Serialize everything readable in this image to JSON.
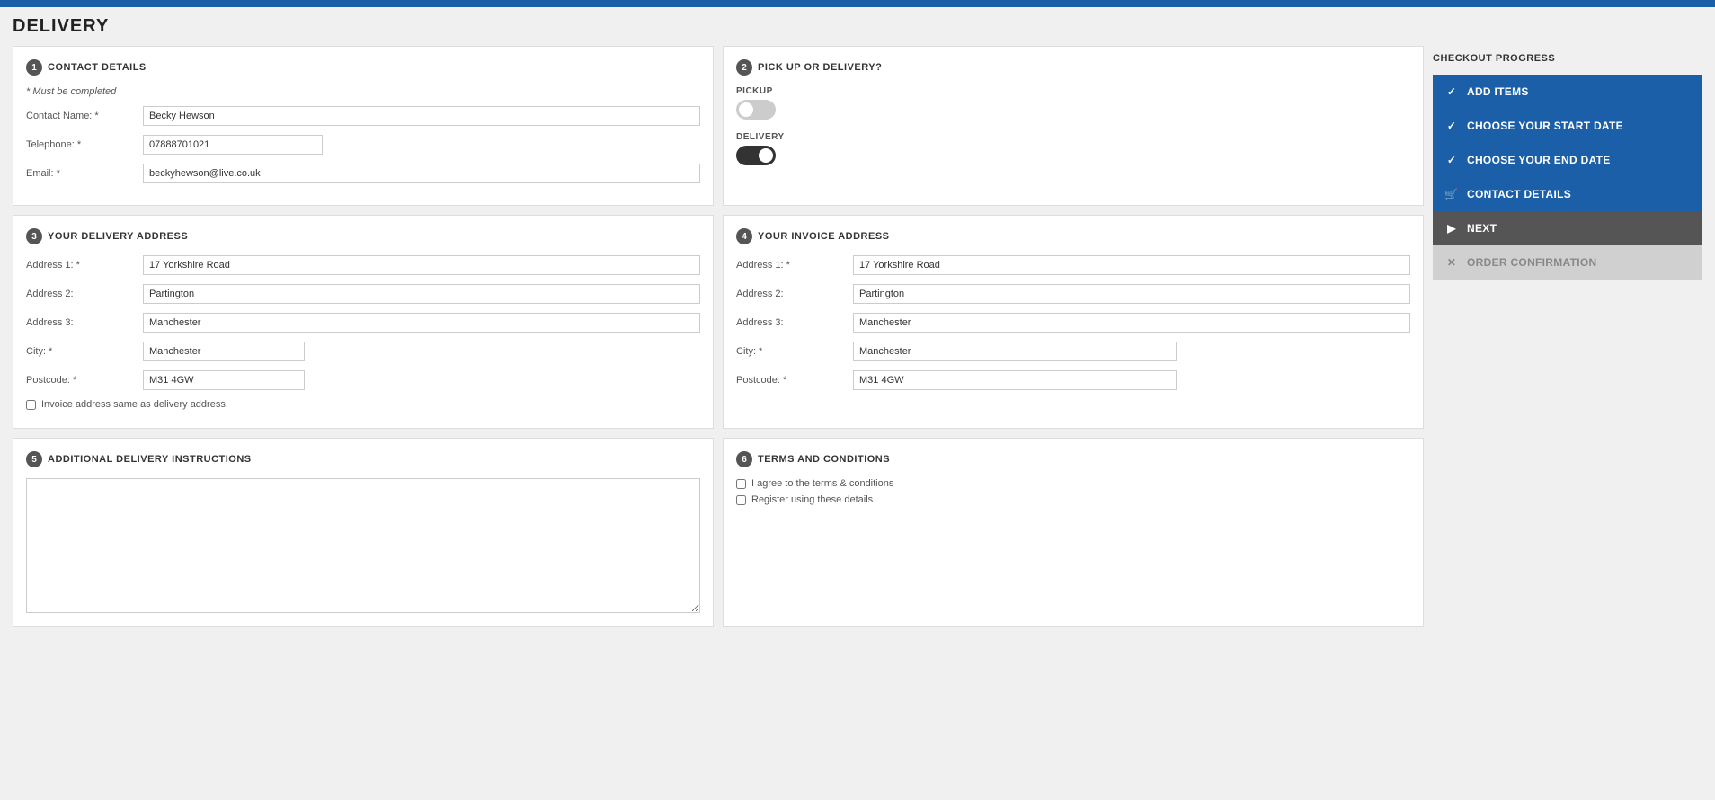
{
  "topBar": {},
  "pageTitle": "Delivery",
  "sections": {
    "contactDetails": {
      "number": "1",
      "title": "Contact Details",
      "mustComplete": "* Must be completed",
      "fields": [
        {
          "label": "Contact Name: *",
          "value": "Becky Hewson",
          "id": "contact-name"
        },
        {
          "label": "Telephone: *",
          "value": "07888701021",
          "id": "telephone"
        },
        {
          "label": "Email: *",
          "value": "beckyhewson@live.co.uk",
          "id": "email"
        }
      ]
    },
    "pickupOrDelivery": {
      "number": "2",
      "title": "Pick Up Or Delivery?",
      "pickupLabel": "PICKUP",
      "deliveryLabel": "DELIVERY",
      "pickupEnabled": false,
      "deliveryEnabled": true
    },
    "deliveryAddress": {
      "number": "3",
      "title": "Your Delivery Address",
      "fields": [
        {
          "label": "Address 1: *",
          "value": "17 Yorkshire Road",
          "id": "del-addr1"
        },
        {
          "label": "Address 2:",
          "value": "Partington",
          "id": "del-addr2"
        },
        {
          "label": "Address 3:",
          "value": "Manchester",
          "id": "del-addr3"
        },
        {
          "label": "City: *",
          "value": "Manchester",
          "id": "del-city"
        },
        {
          "label": "Postcode: *",
          "value": "M31 4GW",
          "id": "del-postcode"
        }
      ],
      "checkboxLabel": "Invoice address same as delivery address."
    },
    "invoiceAddress": {
      "number": "4",
      "title": "Your Invoice Address",
      "fields": [
        {
          "label": "Address 1: *",
          "value": "17 Yorkshire Road",
          "id": "inv-addr1"
        },
        {
          "label": "Address 2:",
          "value": "Partington",
          "id": "inv-addr2"
        },
        {
          "label": "Address 3:",
          "value": "Manchester",
          "id": "inv-addr3"
        },
        {
          "label": "City: *",
          "value": "Manchester",
          "id": "inv-city"
        },
        {
          "label": "Postcode: *",
          "value": "M31 4GW",
          "id": "inv-postcode"
        }
      ]
    },
    "additionalInstructions": {
      "number": "5",
      "title": "Additional Delivery Instructions",
      "value": ""
    },
    "termsAndConditions": {
      "number": "6",
      "title": "Terms And Conditions",
      "checkboxes": [
        {
          "label": "I agree to the terms & conditions",
          "id": "terms-agree"
        },
        {
          "label": "Register using these details",
          "id": "register"
        }
      ]
    }
  },
  "sidebar": {
    "title": "Checkout Progress",
    "items": [
      {
        "label": "Add items",
        "status": "completed",
        "icon": "✓"
      },
      {
        "label": "Choose your start date",
        "status": "completed",
        "icon": "✓"
      },
      {
        "label": "Choose your end date",
        "status": "completed",
        "icon": "✓"
      },
      {
        "label": "Contact Details",
        "status": "completed",
        "icon": "🛒"
      },
      {
        "label": "Next",
        "status": "active",
        "icon": "▶"
      },
      {
        "label": "Order confirmation",
        "status": "inactive",
        "icon": "✕"
      }
    ]
  }
}
